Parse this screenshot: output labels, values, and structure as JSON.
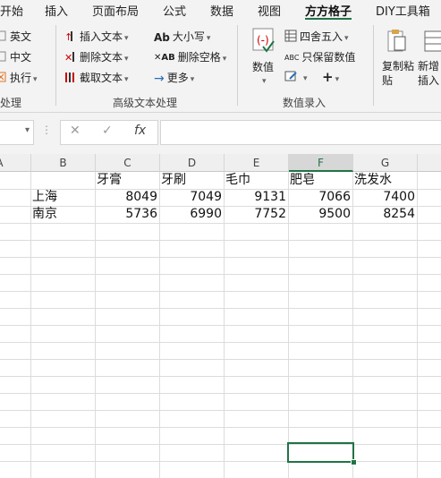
{
  "tabs": [
    "开始",
    "插入",
    "页面布局",
    "公式",
    "数据",
    "视图",
    "方方格子",
    "DIY工具箱"
  ],
  "active_tab": "方方格子",
  "accent_color": "#217346",
  "ribbon": {
    "left_group": {
      "items": [
        "英文",
        "中文",
        "执行"
      ],
      "label": "处理"
    },
    "advanced_text": {
      "label": "高级文本处理",
      "items": [
        "插入文本",
        "删除文本",
        "截取文本",
        "大小写",
        "删除空格",
        "更多"
      ]
    },
    "data_entry": {
      "label": "数值录入",
      "big_button": "数值",
      "items": [
        "四舍五入",
        "只保留数值"
      ]
    },
    "paste": {
      "copy_paste": "复制粘贴",
      "new_insert": "新增插入"
    }
  },
  "formula_bar": {
    "name_box": "",
    "cancel": "✕",
    "enter": "✓",
    "fx": "fx",
    "value": ""
  },
  "columns": [
    "A",
    "B",
    "C",
    "D",
    "E",
    "F",
    "G"
  ],
  "selected_column": "F",
  "table": {
    "headers": [
      "牙膏",
      "牙刷",
      "毛巾",
      "肥皂",
      "洗发水"
    ],
    "rows": [
      {
        "city": "上海",
        "values": [
          "8049",
          "7049",
          "9131",
          "7066",
          "7400"
        ]
      },
      {
        "city": "南京",
        "values": [
          "5736",
          "6990",
          "7752",
          "9500",
          "8254"
        ]
      }
    ]
  }
}
